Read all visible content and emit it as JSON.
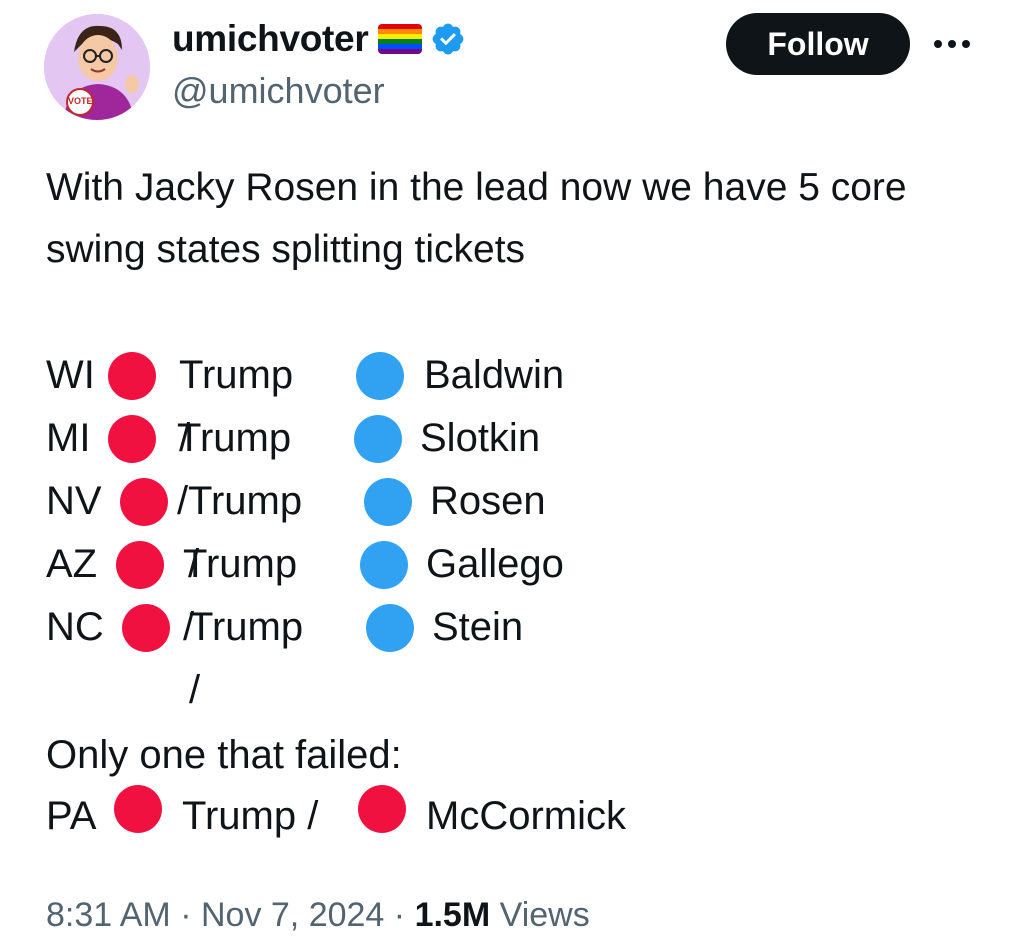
{
  "user": {
    "display_name": "umichvoter",
    "handle": "@umichvoter",
    "avatar_badge": "VOTE"
  },
  "actions": {
    "follow_label": "Follow"
  },
  "tweet": {
    "intro": "With Jacky Rosen in the lead now we have 5 core swing states splitting tickets",
    "states": [
      {
        "code": "WI",
        "left_party": "red",
        "left_label": "Trump /",
        "right_party": "blue",
        "right_label": "Baldwin"
      },
      {
        "code": "MI",
        "left_party": "red",
        "left_label": "Trump /",
        "right_party": "blue",
        "right_label": "Slotkin"
      },
      {
        "code": "NV",
        "left_party": "red",
        "left_label": "Trump /",
        "right_party": "blue",
        "right_label": "Rosen"
      },
      {
        "code": "AZ",
        "left_party": "red",
        "left_label": "Trump /",
        "right_party": "blue",
        "right_label": "Gallego"
      },
      {
        "code": "NC",
        "left_party": "red",
        "left_label": "Trump /",
        "right_party": "blue",
        "right_label": "Stein"
      }
    ],
    "failed_label": "Only one that failed:",
    "failed_state": {
      "code": "PA",
      "left_party": "red",
      "left_label": "Trump /",
      "right_party": "red",
      "right_label": "McCormick"
    }
  },
  "meta": {
    "time": "8:31 AM",
    "separator": "·",
    "date": "Nov 7, 2024",
    "views_count": "1.5M",
    "views_label": "Views"
  },
  "colors": {
    "red_dot": "#f11140",
    "blue_dot": "#31a2f2",
    "verified": "#1d9bf0",
    "text_secondary": "#536471"
  },
  "icons": {
    "flag": "rainbow-flag-icon",
    "verified": "verified-badge-icon",
    "more": "more-options-icon"
  }
}
